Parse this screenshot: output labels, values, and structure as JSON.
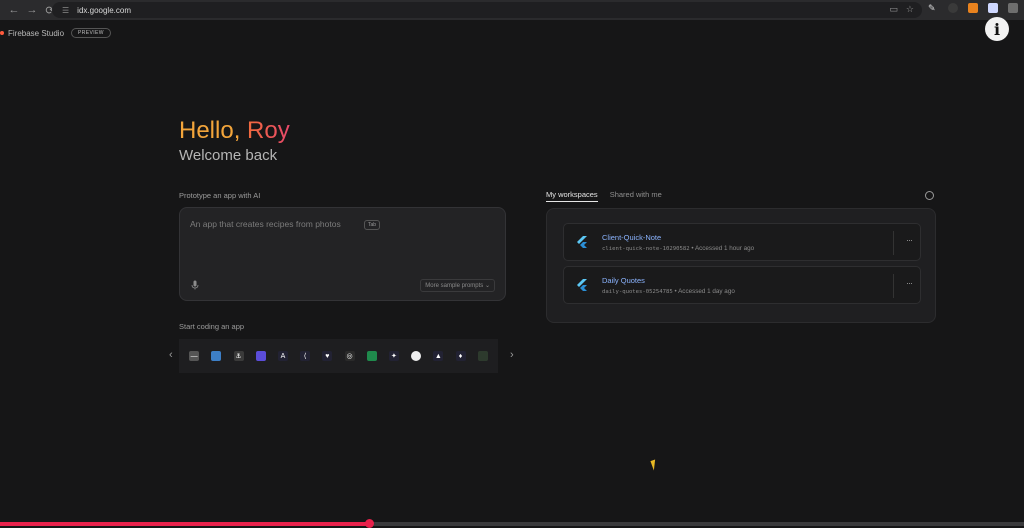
{
  "browser": {
    "url": "idx.google.com",
    "nav": {
      "back": "←",
      "forward": "→",
      "reload": "⟳"
    }
  },
  "app": {
    "brand": "Firebase Studio",
    "badge": "PREVIEW"
  },
  "hero": {
    "hello": "Hello,",
    "name": "Roy",
    "subtitle": "Welcome back"
  },
  "prototype": {
    "label": "Prototype an app with AI",
    "placeholder": "An app that creates recipes from photos",
    "tab_hint": "Tab",
    "more_prompts": "More sample prompts"
  },
  "start_coding": {
    "label": "Start coding an app",
    "templates": [
      {
        "icon": "dash-icon",
        "color": "#555555",
        "glyph": "—"
      },
      {
        "icon": "python-icon",
        "color": "#3d7fc7",
        "glyph": ""
      },
      {
        "icon": "android-icon",
        "color": "#3a3a3a",
        "glyph": "⚓"
      },
      {
        "icon": "nextjs-icon",
        "color": "#5b4dd9",
        "glyph": ""
      },
      {
        "icon": "astro-icon",
        "color": "#222233",
        "glyph": "A"
      },
      {
        "icon": "flutter-icon",
        "color": "#222233",
        "glyph": "⟨"
      },
      {
        "icon": "svelte-icon",
        "color": "#222233",
        "glyph": "♥"
      },
      {
        "icon": "github-icon",
        "color": "#2a2a2a",
        "glyph": "◎"
      },
      {
        "icon": "vue-icon",
        "color": "#1f8a4c",
        "glyph": ""
      },
      {
        "icon": "kotlin-icon",
        "color": "#222233",
        "glyph": "✦"
      },
      {
        "icon": "go-icon",
        "color": "#f0f0f0",
        "glyph": ""
      },
      {
        "icon": "angular-icon",
        "color": "#222233",
        "glyph": "▲"
      },
      {
        "icon": "node-icon",
        "color": "#222233",
        "glyph": "♦"
      },
      {
        "icon": "blank-icon",
        "color": "#2d3a2d",
        "glyph": ""
      }
    ],
    "prev": "‹",
    "next": "›"
  },
  "workspaces": {
    "tabs": [
      {
        "label": "My workspaces"
      },
      {
        "label": "Shared with me"
      }
    ],
    "items": [
      {
        "name": "Client-Quick-Note",
        "id": "client-quick-note-10290582",
        "sep": "•",
        "accessed": "Accessed 1 hour ago"
      },
      {
        "name": "Daily Quotes",
        "id": "daily-quotes-05254785",
        "sep": "•",
        "accessed": "Accessed 1 day ago"
      }
    ],
    "more": "···"
  },
  "overlay": {
    "info": "i"
  },
  "video_progress": 0.36,
  "colors": {
    "accent_orange": "#f3a53b",
    "accent_pink": "#e8486b",
    "link_blue": "#8bb4ff",
    "progress_red": "#e8214b"
  }
}
